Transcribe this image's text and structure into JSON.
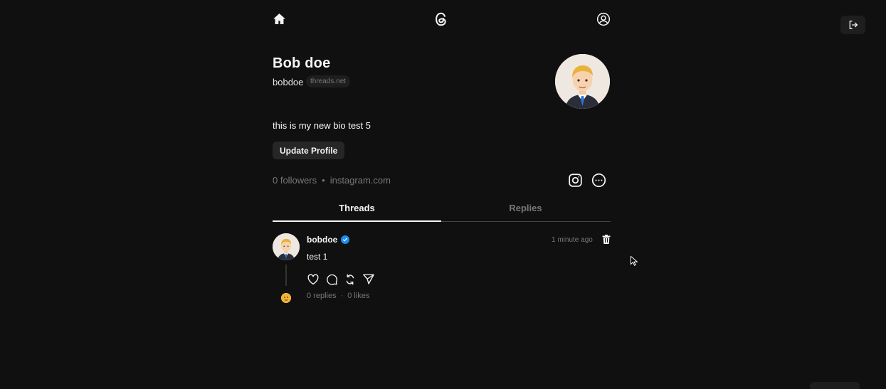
{
  "nav": {
    "home_icon": "home-icon",
    "logo_icon": "threads-logo-icon",
    "profile_icon": "user-icon",
    "logout_icon": "logout-icon"
  },
  "profile": {
    "name": "Bob doe",
    "username": "bobdoe",
    "domain_badge": "threads.net",
    "bio": "this is my new bio test 5",
    "update_button": "Update Profile",
    "followers": "0 followers",
    "separator": "•",
    "link": "instagram.com"
  },
  "tabs": [
    {
      "label": "Threads",
      "active": true
    },
    {
      "label": "Replies",
      "active": false
    }
  ],
  "post": {
    "username": "bobdoe",
    "verified": true,
    "time": "1 minute ago",
    "text": "test 1",
    "replies": "0 replies",
    "separator": "·",
    "likes": "0 likes"
  },
  "colors": {
    "background": "#101010",
    "text": "#f3f5f7",
    "muted": "#777777",
    "verified": "#1d8cf0"
  }
}
